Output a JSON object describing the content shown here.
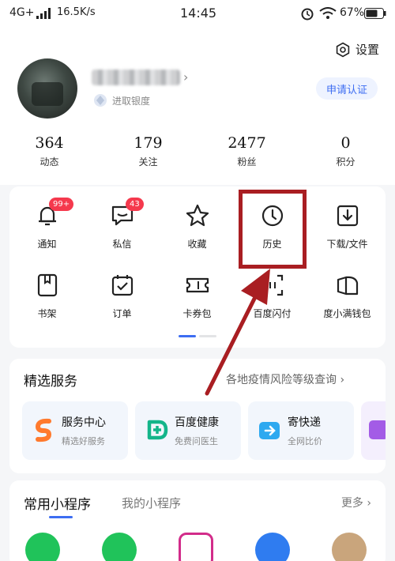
{
  "status_bar": {
    "network": "4G+",
    "speed": "16.5K/s",
    "time": "14:45",
    "battery": "67%"
  },
  "header": {
    "settings_label": "设置",
    "level_label": "进取银度",
    "verify_button": "申请认证"
  },
  "stats": [
    {
      "value": "364",
      "label": "动态"
    },
    {
      "value": "179",
      "label": "关注"
    },
    {
      "value": "2477",
      "label": "粉丝"
    },
    {
      "value": "0",
      "label": "积分"
    }
  ],
  "grid": [
    {
      "label": "通知",
      "icon": "bell-icon",
      "badge": "99+"
    },
    {
      "label": "私信",
      "icon": "message-icon",
      "badge": "43"
    },
    {
      "label": "收藏",
      "icon": "star-icon"
    },
    {
      "label": "历史",
      "icon": "clock-icon"
    },
    {
      "label": "下载/文件",
      "icon": "download-icon"
    },
    {
      "label": "书架",
      "icon": "bookshelf-icon"
    },
    {
      "label": "订单",
      "icon": "order-icon"
    },
    {
      "label": "卡券包",
      "icon": "ticket-icon"
    },
    {
      "label": "百度闪付",
      "icon": "scan-pay-icon"
    },
    {
      "label": "度小满钱包",
      "icon": "wallet-icon"
    }
  ],
  "services": {
    "title": "精选服务",
    "link": "各地疫情风险等级查询",
    "tiles": [
      {
        "title": "服务中心",
        "subtitle": "精选好服务",
        "icon": "service-center-icon"
      },
      {
        "title": "百度健康",
        "subtitle": "免费问医生",
        "icon": "health-icon"
      },
      {
        "title": "寄快递",
        "subtitle": "全网比价",
        "icon": "express-icon"
      }
    ]
  },
  "mini_programs": {
    "tab_active": "常用小程序",
    "tab_inactive": "我的小程序",
    "more": "更多"
  },
  "colors": {
    "accent": "#3d6df2",
    "badge": "#f5394d",
    "annotation": "#a91e22"
  }
}
